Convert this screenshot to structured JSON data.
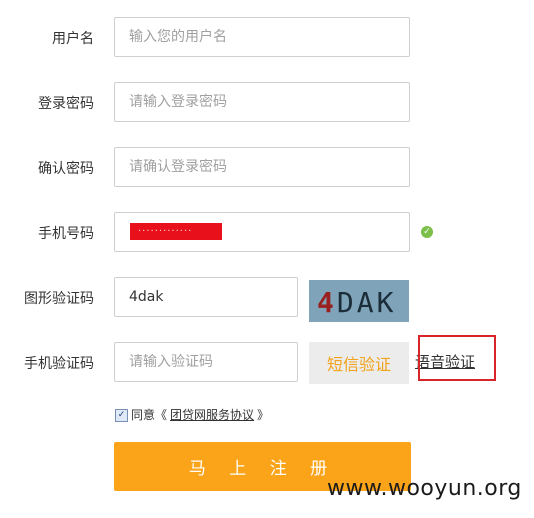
{
  "form": {
    "username": {
      "label": "用户名",
      "placeholder": "输入您的用户名"
    },
    "password": {
      "label": "登录密码",
      "placeholder": "请输入登录密码"
    },
    "confirm_password": {
      "label": "确认密码",
      "placeholder": "请确认登录密码"
    },
    "phone": {
      "label": "手机号码",
      "value_redacted": "·············"
    },
    "captcha": {
      "label": "图形验证码",
      "value": "4dak",
      "image_text_digit": "4",
      "image_text_letters": "DAK"
    },
    "sms_code": {
      "label": "手机验证码",
      "placeholder": "请输入验证码",
      "send_button": "短信验证",
      "voice_link": "语音验证"
    },
    "agreement": {
      "prefix": "同意《",
      "link": "团贷网服务协议",
      "suffix": "》",
      "checked": true
    },
    "submit_label": "马 上 注 册"
  },
  "watermark": "www.wooyun.org",
  "colors": {
    "accent": "#fba419",
    "sms_text": "#f2a21b",
    "highlight": "#d8252a",
    "redaction": "#e8101a",
    "ok": "#7cc04a"
  }
}
